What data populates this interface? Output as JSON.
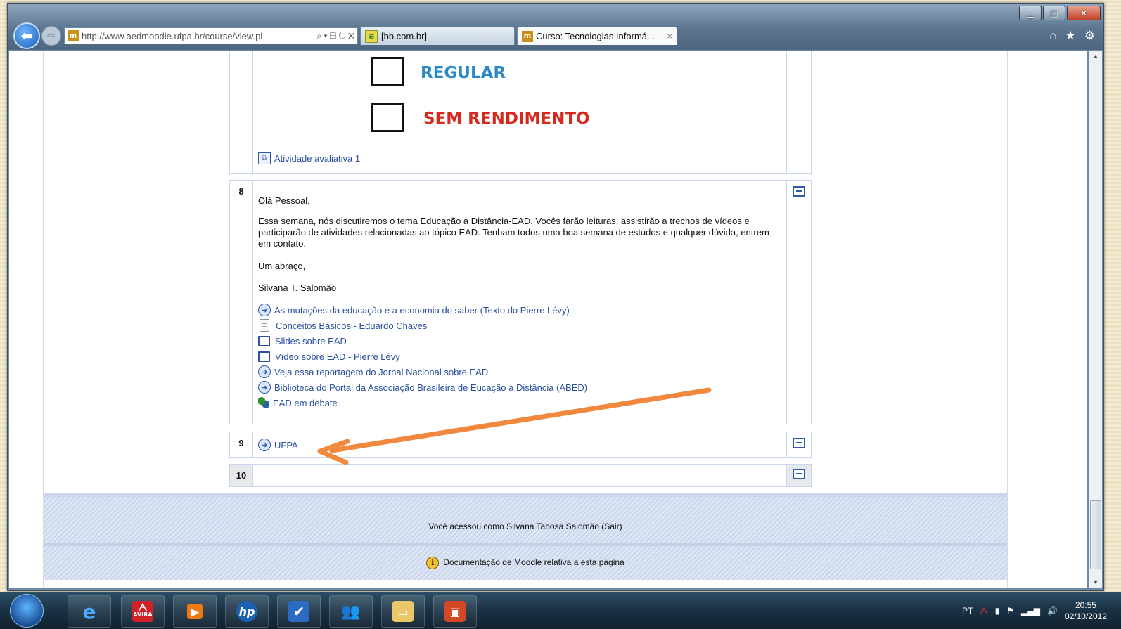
{
  "browser": {
    "window_controls": {
      "minimize": "▁",
      "maximize": "□",
      "close": "✕"
    },
    "back_glyph": "⬅",
    "forward_glyph": "⇨",
    "address_url": "http://www.aedmoodle.ufpa.br/course/view.pl",
    "address_tools": "⌕ ▾ ▤ ↻ ✕",
    "favicon": "m",
    "tabs": [
      {
        "label": "[bb.com.br]",
        "icon": "bb-icon"
      },
      {
        "label": "Curso: Tecnologias Informá...",
        "close": "×",
        "icon": "moodle-icon"
      }
    ],
    "toolbar_icons": {
      "home": "⌂",
      "favorites": "★",
      "tools": "⚙"
    }
  },
  "content": {
    "checkboxes": [
      {
        "label": "REGULAR",
        "color": "#2a88c8"
      },
      {
        "label": "SEM RENDIMENTO",
        "color": "#d8281c"
      }
    ],
    "section7_link": "Atividade avaliativa 1",
    "section8": {
      "number": "8",
      "greeting": "Olá Pessoal,",
      "paragraph": "Essa semana, nós discutiremos o tema Educação a Distância-EAD. Vocês farão leituras, assistirão a trechos de vídeos e participarão de atividades relacionadas ao tópico EAD. Tenham todos uma boa semana de estudos e qualquer dúvida, entrem em contato.",
      "closing": "Um abraço,",
      "signature": "Silvana T. Salomão",
      "links": [
        {
          "label": "As mutações da educação e a economia do saber (Texto do Pierre Lévy)",
          "icon": "url-globe-icon"
        },
        {
          "label": "Conceitos Básicos - Eduardo Chaves",
          "icon": "document-icon"
        },
        {
          "label": "Slides sobre EAD",
          "icon": "monitor-icon"
        },
        {
          "label": "Vídeo sobre EAD - Pierre Lévy",
          "icon": "monitor-icon"
        },
        {
          "label": "Veja essa reportagem do Jornal Nacional sobre EAD",
          "icon": "url-globe-icon"
        },
        {
          "label": "Biblioteca do Portal da Associação Brasileira de Eucação a Distância (ABED)",
          "icon": "url-globe-icon"
        },
        {
          "label": "EAD em debate",
          "icon": "forum-icon"
        }
      ]
    },
    "section9": {
      "number": "9",
      "link": "UFPA"
    },
    "section10": {
      "number": "10"
    },
    "footer": {
      "logged_in": "Você acessou como Silvana Tabosa Salomão (Sair)",
      "docs": "Documentação de Moodle relativa a esta página"
    },
    "annotation_arrow_color": "#f0883e"
  },
  "taskbar": {
    "apps": [
      "internet-explorer",
      "avira",
      "media-player",
      "hp",
      "task-check",
      "messenger",
      "file-explorer",
      "presentation"
    ],
    "app_labels": {
      "avira": "AVIRA"
    },
    "language": "PT",
    "time": "20:55",
    "date": "02/10/2012"
  }
}
